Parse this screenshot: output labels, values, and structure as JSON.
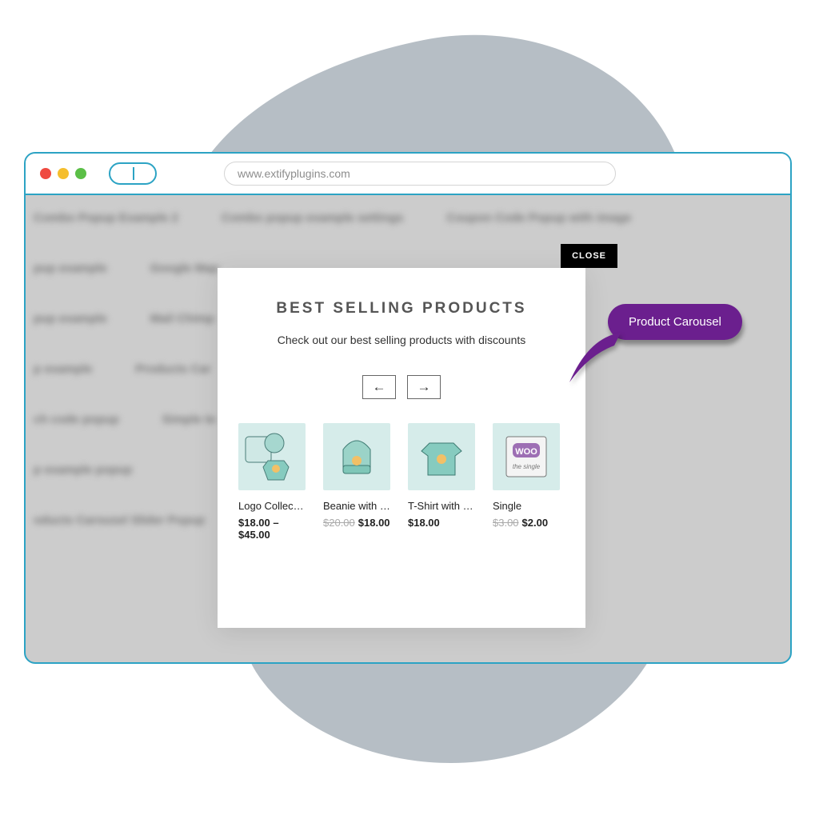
{
  "url": "www.extifyplugins.com",
  "popup": {
    "close_label": "CLOSE",
    "title": "BEST SELLING PRODUCTS",
    "subtitle": "Check out our best selling products with discounts"
  },
  "products": [
    {
      "name": "Logo Collec…",
      "price": "$18.00 – $45.00",
      "original": ""
    },
    {
      "name": "Beanie with …",
      "price": "$18.00",
      "original": "$20.00"
    },
    {
      "name": "T-Shirt with …",
      "price": "$18.00",
      "original": ""
    },
    {
      "name": "Single",
      "price": "$2.00",
      "original": "$3.00"
    }
  ],
  "callout": {
    "label": "Product Carousel"
  }
}
